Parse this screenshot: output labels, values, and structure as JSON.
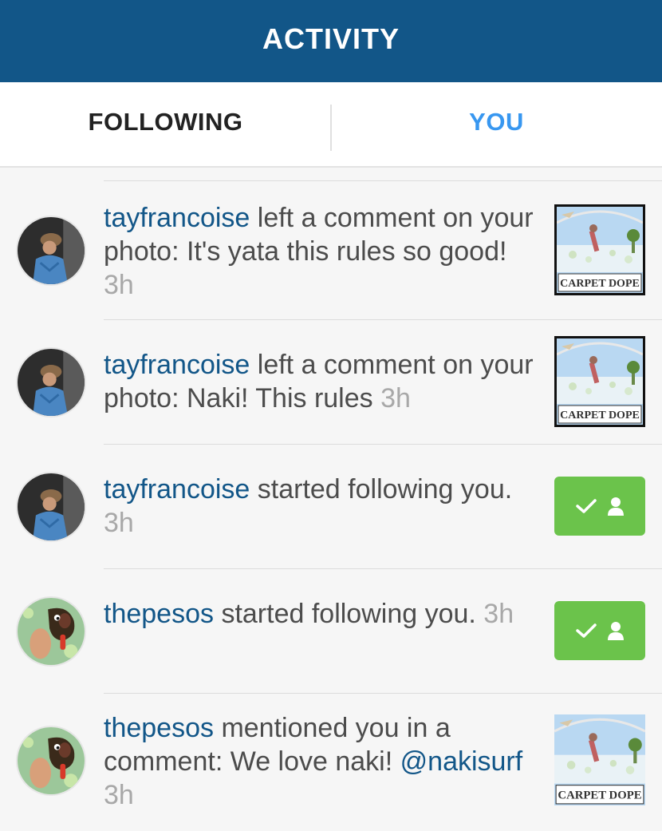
{
  "header": {
    "title": "ACTIVITY"
  },
  "tabs": [
    {
      "label": "FOLLOWING",
      "active": false
    },
    {
      "label": "YOU",
      "active": true
    }
  ],
  "colors": {
    "header": "#125688",
    "username": "#125688",
    "active_tab": "#3897f0",
    "follow_button": "#6bc34b",
    "time": "#a8a8a8"
  },
  "thumbnail": {
    "caption": "CARPET DOPE"
  },
  "feed": [
    {
      "avatar": "avatar-tayfrancoise",
      "username": "tayfrancoise",
      "text": " left a comment on your photo: It's yata this rules so good!",
      "time": "3h",
      "action": "photo-thumbnail"
    },
    {
      "avatar": "avatar-tayfrancoise",
      "username": "tayfrancoise",
      "text": " left a comment on your photo: Naki! This rules",
      "time": "3h",
      "action": "photo-thumbnail"
    },
    {
      "avatar": "avatar-tayfrancoise",
      "username": "tayfrancoise",
      "text": " started following you.",
      "time": "3h",
      "action": "following-button",
      "action_icons": [
        "check-icon",
        "person-icon"
      ]
    },
    {
      "avatar": "avatar-thepesos",
      "username": "thepesos",
      "text": " started following you.",
      "time": "3h",
      "action": "following-button",
      "action_icons": [
        "check-icon",
        "person-icon"
      ]
    },
    {
      "avatar": "avatar-thepesos",
      "username": "thepesos",
      "text": " mentioned you in a comment: We love naki! ",
      "mention": "@nakisurf",
      "time": "3h",
      "action": "photo-thumbnail"
    }
  ]
}
